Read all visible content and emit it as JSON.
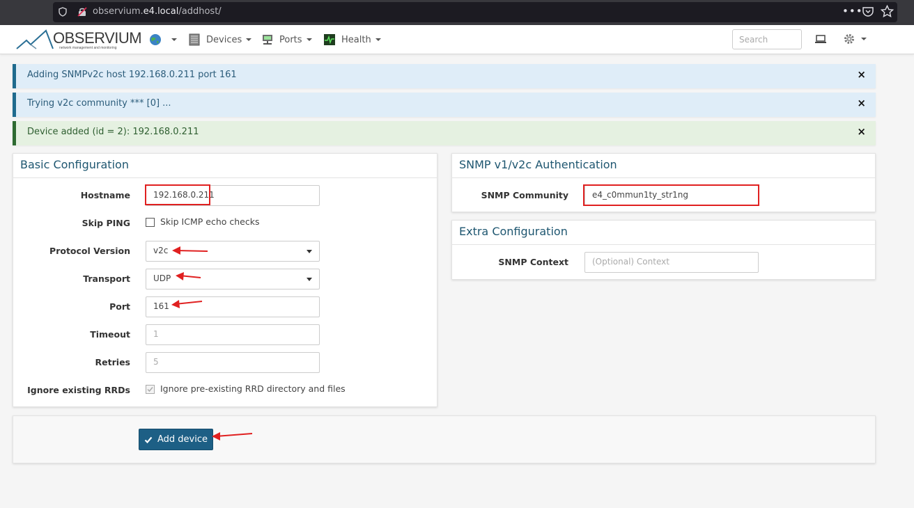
{
  "browser": {
    "url_prefix": "observium.",
    "url_host": "e4.local",
    "url_path": "/addhost/",
    "menu_dots": "•••"
  },
  "navbar": {
    "logo_text": "OBSERVIUM",
    "logo_subtitle": "network management and monitoring",
    "items": [
      {
        "label": "",
        "icon": "globe-icon"
      },
      {
        "label": "Devices",
        "icon": "server-icon"
      },
      {
        "label": "Ports",
        "icon": "network-port-icon"
      },
      {
        "label": "Health",
        "icon": "heartbeat-icon"
      }
    ],
    "search_placeholder": "Search"
  },
  "alerts": [
    {
      "text": "Adding SNMPv2c host 192.168.0.211 port 161",
      "type": "info",
      "close": "×"
    },
    {
      "text": "Trying v2c community *** [0] ...",
      "type": "info",
      "close": "×"
    },
    {
      "text": "Device added (id = 2): 192.168.0.211",
      "type": "success",
      "close": "×"
    }
  ],
  "basic": {
    "title": "Basic Configuration",
    "hostname_label": "Hostname",
    "hostname_value": "192.168.0.211",
    "skip_ping_label": "Skip PING",
    "skip_ping_text": "Skip ICMP echo checks",
    "protocol_label": "Protocol Version",
    "protocol_value": "v2c",
    "transport_label": "Transport",
    "transport_value": "UDP",
    "port_label": "Port",
    "port_value": "161",
    "timeout_label": "Timeout",
    "timeout_placeholder": "1",
    "retries_label": "Retries",
    "retries_placeholder": "5",
    "ignore_rrd_label": "Ignore existing RRDs",
    "ignore_rrd_text": "Ignore pre-existing RRD directory and files"
  },
  "snmp": {
    "title": "SNMP v1/v2c Authentication",
    "community_label": "SNMP Community",
    "community_value": "e4_c0mmun1ty_str1ng"
  },
  "extra": {
    "title": "Extra Configuration",
    "context_label": "SNMP Context",
    "context_placeholder": "(Optional) Context"
  },
  "footer": {
    "add_button": "Add device"
  },
  "colors": {
    "accent": "#1d5f85",
    "annotation": "#e02020",
    "info_alert_bg": "#dfedf8",
    "success_alert_bg": "#e5f1e1"
  }
}
